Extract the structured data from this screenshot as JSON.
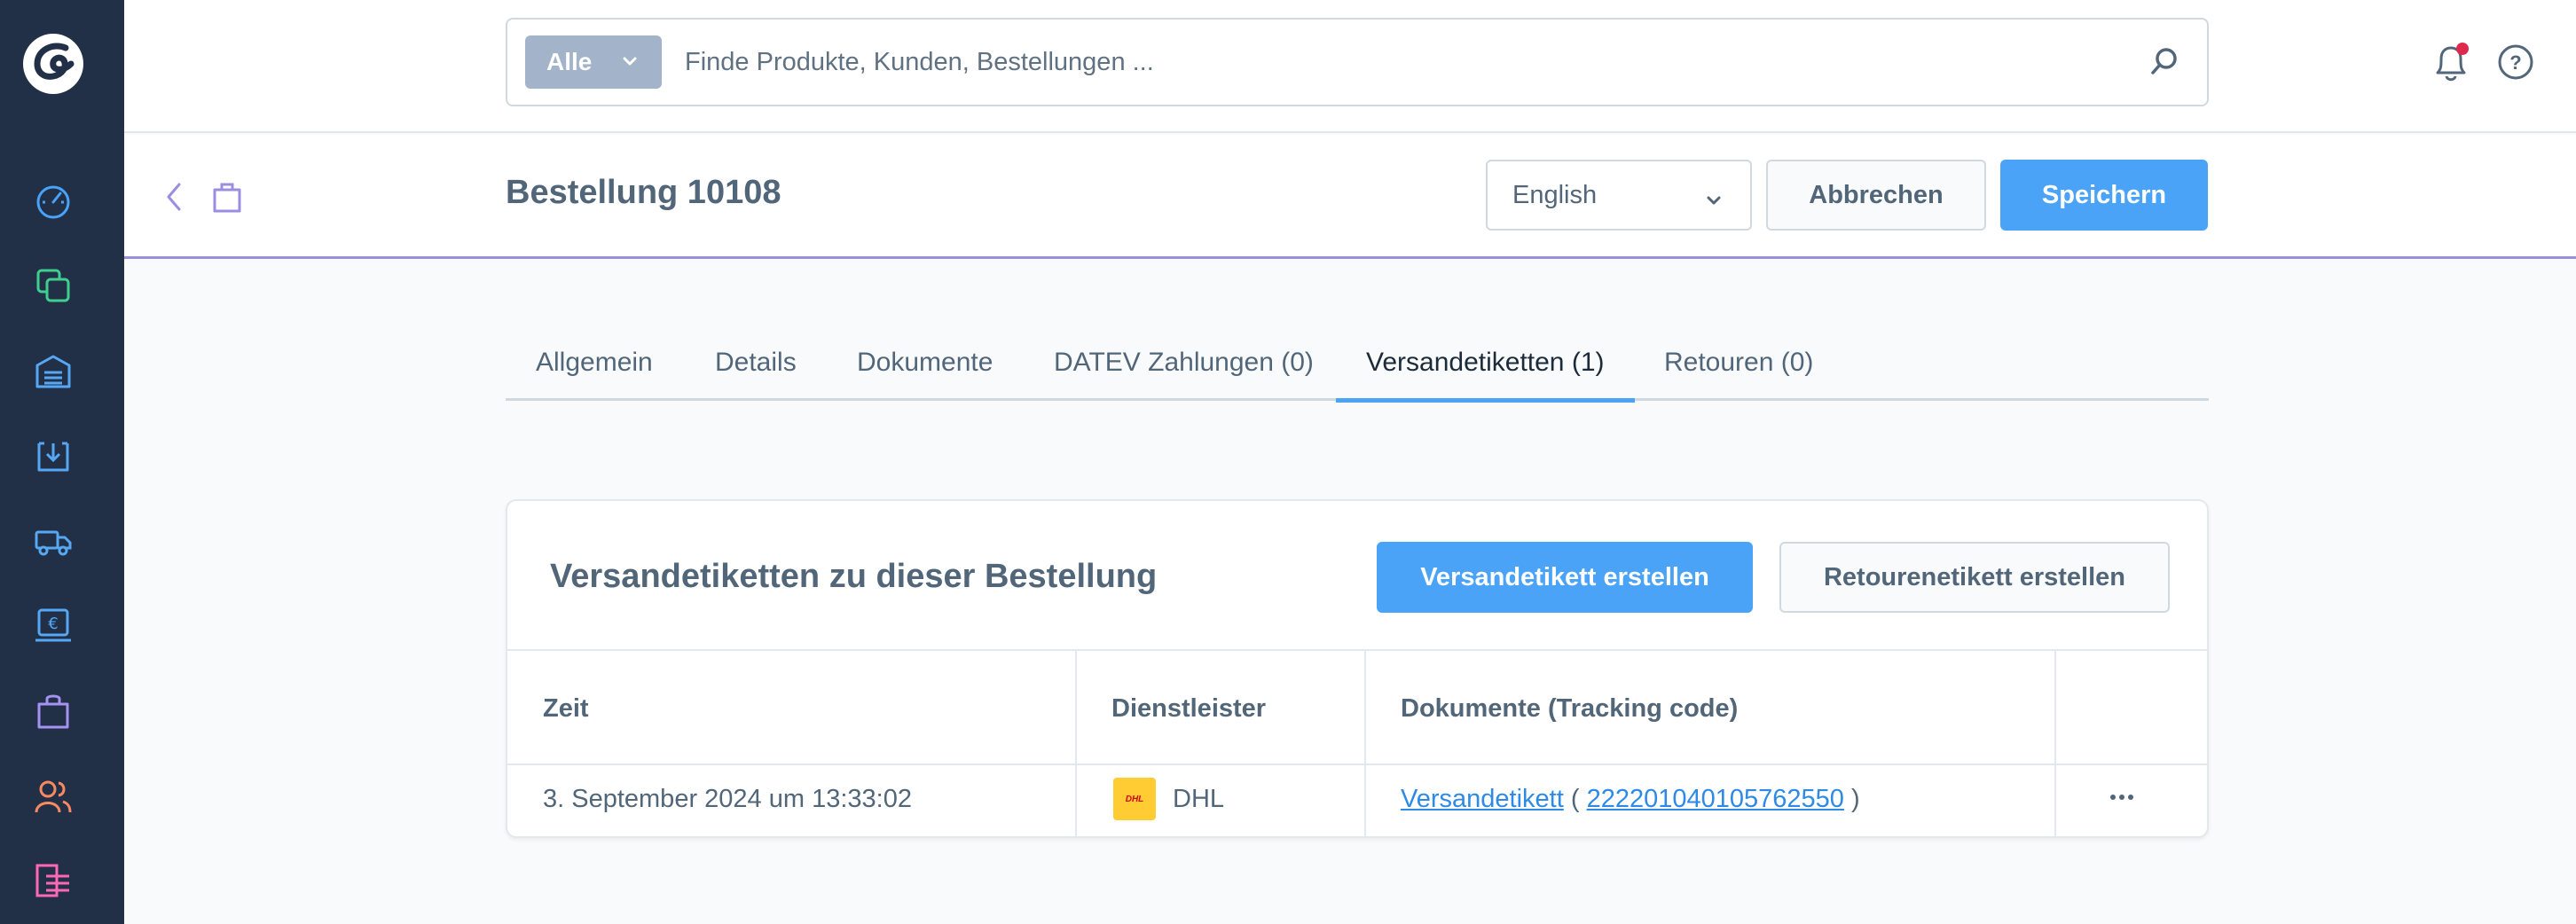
{
  "header": {
    "search_type": "Alle",
    "search_placeholder": "Finde Produkte, Kunden, Bestellungen ..."
  },
  "page": {
    "title": "Bestellung 10108",
    "language": "English",
    "cancel_label": "Abbrechen",
    "save_label": "Speichern"
  },
  "tabs": [
    {
      "label": "Allgemein"
    },
    {
      "label": "Details"
    },
    {
      "label": "Dokumente"
    },
    {
      "label": "DATEV Zahlungen (0)"
    },
    {
      "label": "Versandetiketten (1)",
      "active": true
    },
    {
      "label": "Retouren (0)"
    }
  ],
  "card": {
    "title": "Versandetiketten zu dieser Bestellung",
    "create_label_button": "Versandetikett erstellen",
    "create_return_button": "Retourenetikett erstellen",
    "columns": [
      "Zeit",
      "Dienstleister",
      "Dokumente (Tracking code)",
      ""
    ],
    "rows": [
      {
        "time": "3. September 2024 um 13:33:02",
        "carrier": "DHL",
        "carrier_logo_text": "DHL",
        "document": "Versandetikett",
        "paren_open": "(",
        "tracking_code": "222201040105762550",
        "paren_close": ")"
      }
    ]
  },
  "colors": {
    "sidebar": "#212f47",
    "primary": "#4aa3f7",
    "header_accent": "#9a8ee0",
    "notification_dot": "#de294c"
  },
  "icons": {
    "nav": [
      "dashboard-icon",
      "products-icon",
      "warehouse-icon",
      "inbox-icon",
      "truck-icon",
      "payment-icon",
      "orders-icon",
      "customers-icon",
      "content-icon"
    ]
  }
}
